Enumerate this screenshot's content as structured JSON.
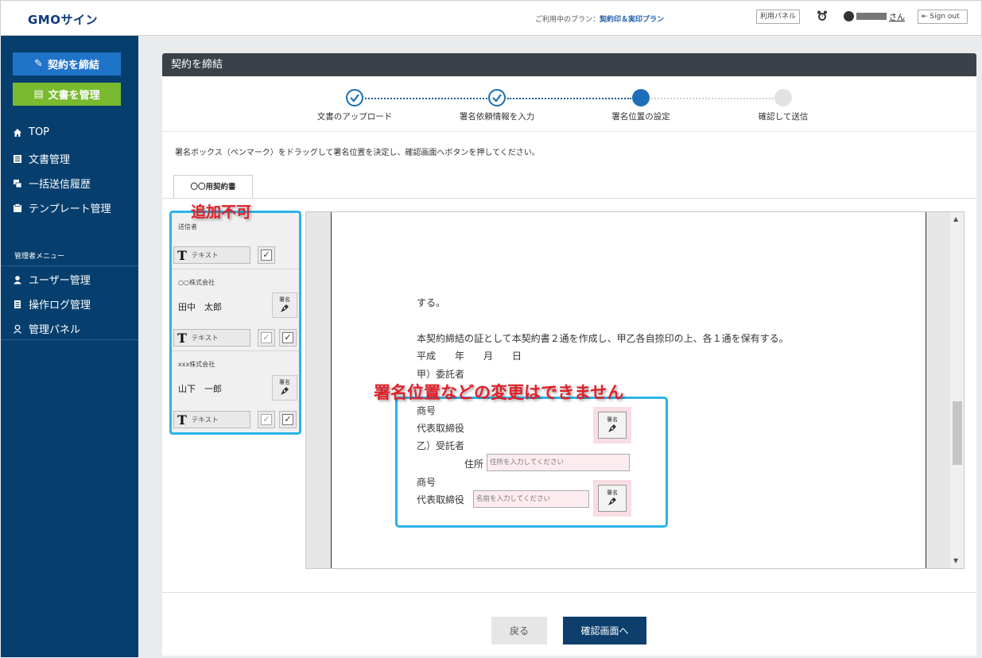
{
  "header": {
    "logo": "GMOサイン",
    "plan_label": "ご利用中のプラン：",
    "plan_name": "契約印＆実印プラン",
    "panel_button": "利用パネル",
    "user_suffix": "さん",
    "signout": "Sign out"
  },
  "sidebar": {
    "primary_button": "契約を締結",
    "secondary_button": "文書を管理",
    "items": [
      {
        "label": "TOP",
        "icon": "home-icon"
      },
      {
        "label": "文書管理",
        "icon": "document-icon"
      },
      {
        "label": "一括送信履歴",
        "icon": "batch-icon"
      },
      {
        "label": "テンプレート管理",
        "icon": "template-icon"
      }
    ],
    "admin_label": "管理者メニュー",
    "admin_items": [
      {
        "label": "ユーザー管理",
        "icon": "user-icon"
      },
      {
        "label": "操作ログ管理",
        "icon": "log-icon"
      },
      {
        "label": "管理パネル",
        "icon": "admin-panel-icon"
      }
    ]
  },
  "main": {
    "title": "契約を締結",
    "steps": [
      {
        "label": "文書のアップロード",
        "state": "done"
      },
      {
        "label": "署名依頼情報を入力",
        "state": "done"
      },
      {
        "label": "署名位置の設定",
        "state": "active"
      },
      {
        "label": "確認して送信",
        "state": "todo"
      }
    ],
    "instruction": "署名ボックス（ペンマーク）をドラッグして署名位置を決定し、確認画面へボタンを押してください。",
    "tab": "〇〇用契約書",
    "signers": {
      "sender_label": "送信者",
      "text_label": "テキスト",
      "seal_label": "署名",
      "groups": [
        {
          "company": "○○株式会社",
          "person": "田中　太郎"
        },
        {
          "company": "xxx株式会社",
          "person": "山下　一郎"
        }
      ]
    },
    "document": {
      "lines": [
        "する。",
        "本契約締結の証として本契約書２通を作成し、甲乙各自捺印の上、各１通を保有する。",
        "平成　　年　　月　　日",
        "甲）委託者",
        "商号",
        "代表取締役",
        "乙）受託者",
        "住所",
        "商号",
        "代表取締役"
      ],
      "address_placeholder": "住所を入力してください",
      "name_placeholder": "名前を入力してください"
    },
    "back_button": "戻る",
    "next_button": "確認画面へ"
  },
  "annotations": {
    "cannot_add": "追加不可",
    "cannot_change": "署名位置などの変更はできません"
  },
  "colors": {
    "sidebar": "#063f6e",
    "primary": "#1f73c8",
    "green": "#79ba2e",
    "highlight": "#2db3e8",
    "annotation": "#e0202a"
  }
}
